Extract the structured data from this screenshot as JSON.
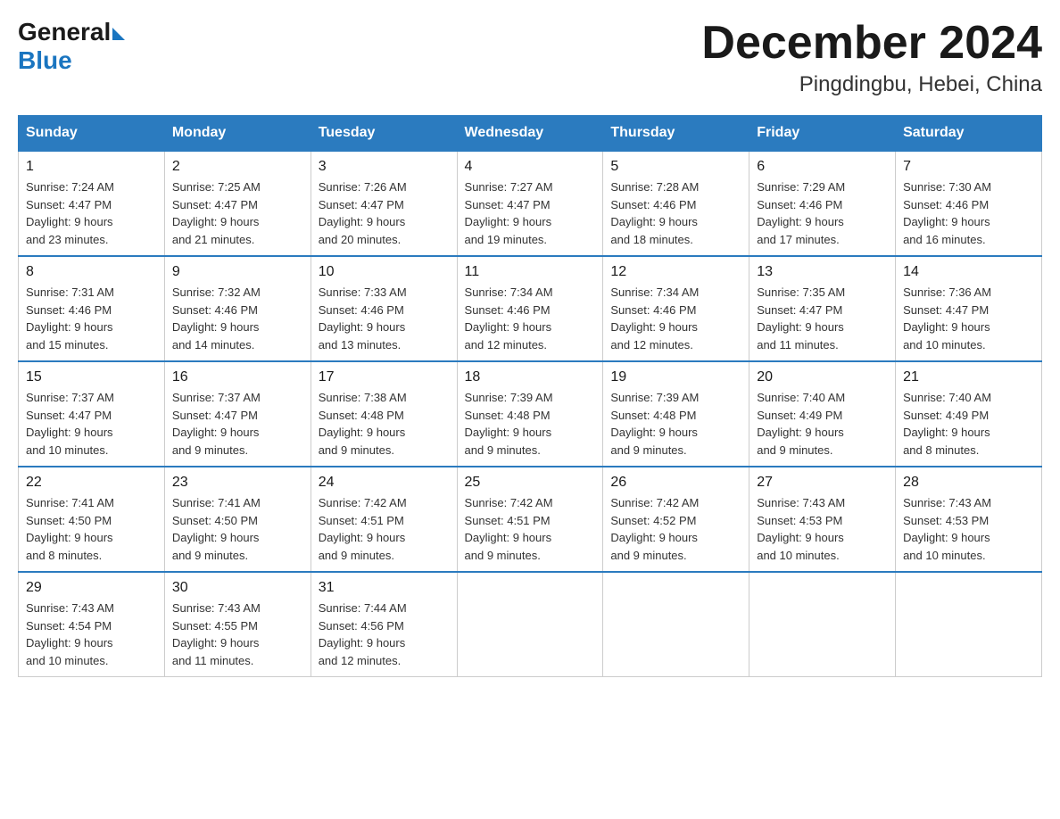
{
  "logo": {
    "general": "General",
    "blue": "Blue"
  },
  "title": "December 2024",
  "location": "Pingdingbu, Hebei, China",
  "days_of_week": [
    "Sunday",
    "Monday",
    "Tuesday",
    "Wednesday",
    "Thursday",
    "Friday",
    "Saturday"
  ],
  "weeks": [
    [
      {
        "day": "1",
        "sunrise": "7:24 AM",
        "sunset": "4:47 PM",
        "daylight": "9 hours and 23 minutes."
      },
      {
        "day": "2",
        "sunrise": "7:25 AM",
        "sunset": "4:47 PM",
        "daylight": "9 hours and 21 minutes."
      },
      {
        "day": "3",
        "sunrise": "7:26 AM",
        "sunset": "4:47 PM",
        "daylight": "9 hours and 20 minutes."
      },
      {
        "day": "4",
        "sunrise": "7:27 AM",
        "sunset": "4:47 PM",
        "daylight": "9 hours and 19 minutes."
      },
      {
        "day": "5",
        "sunrise": "7:28 AM",
        "sunset": "4:46 PM",
        "daylight": "9 hours and 18 minutes."
      },
      {
        "day": "6",
        "sunrise": "7:29 AM",
        "sunset": "4:46 PM",
        "daylight": "9 hours and 17 minutes."
      },
      {
        "day": "7",
        "sunrise": "7:30 AM",
        "sunset": "4:46 PM",
        "daylight": "9 hours and 16 minutes."
      }
    ],
    [
      {
        "day": "8",
        "sunrise": "7:31 AM",
        "sunset": "4:46 PM",
        "daylight": "9 hours and 15 minutes."
      },
      {
        "day": "9",
        "sunrise": "7:32 AM",
        "sunset": "4:46 PM",
        "daylight": "9 hours and 14 minutes."
      },
      {
        "day": "10",
        "sunrise": "7:33 AM",
        "sunset": "4:46 PM",
        "daylight": "9 hours and 13 minutes."
      },
      {
        "day": "11",
        "sunrise": "7:34 AM",
        "sunset": "4:46 PM",
        "daylight": "9 hours and 12 minutes."
      },
      {
        "day": "12",
        "sunrise": "7:34 AM",
        "sunset": "4:46 PM",
        "daylight": "9 hours and 12 minutes."
      },
      {
        "day": "13",
        "sunrise": "7:35 AM",
        "sunset": "4:47 PM",
        "daylight": "9 hours and 11 minutes."
      },
      {
        "day": "14",
        "sunrise": "7:36 AM",
        "sunset": "4:47 PM",
        "daylight": "9 hours and 10 minutes."
      }
    ],
    [
      {
        "day": "15",
        "sunrise": "7:37 AM",
        "sunset": "4:47 PM",
        "daylight": "9 hours and 10 minutes."
      },
      {
        "day": "16",
        "sunrise": "7:37 AM",
        "sunset": "4:47 PM",
        "daylight": "9 hours and 9 minutes."
      },
      {
        "day": "17",
        "sunrise": "7:38 AM",
        "sunset": "4:48 PM",
        "daylight": "9 hours and 9 minutes."
      },
      {
        "day": "18",
        "sunrise": "7:39 AM",
        "sunset": "4:48 PM",
        "daylight": "9 hours and 9 minutes."
      },
      {
        "day": "19",
        "sunrise": "7:39 AM",
        "sunset": "4:48 PM",
        "daylight": "9 hours and 9 minutes."
      },
      {
        "day": "20",
        "sunrise": "7:40 AM",
        "sunset": "4:49 PM",
        "daylight": "9 hours and 9 minutes."
      },
      {
        "day": "21",
        "sunrise": "7:40 AM",
        "sunset": "4:49 PM",
        "daylight": "9 hours and 8 minutes."
      }
    ],
    [
      {
        "day": "22",
        "sunrise": "7:41 AM",
        "sunset": "4:50 PM",
        "daylight": "9 hours and 8 minutes."
      },
      {
        "day": "23",
        "sunrise": "7:41 AM",
        "sunset": "4:50 PM",
        "daylight": "9 hours and 9 minutes."
      },
      {
        "day": "24",
        "sunrise": "7:42 AM",
        "sunset": "4:51 PM",
        "daylight": "9 hours and 9 minutes."
      },
      {
        "day": "25",
        "sunrise": "7:42 AM",
        "sunset": "4:51 PM",
        "daylight": "9 hours and 9 minutes."
      },
      {
        "day": "26",
        "sunrise": "7:42 AM",
        "sunset": "4:52 PM",
        "daylight": "9 hours and 9 minutes."
      },
      {
        "day": "27",
        "sunrise": "7:43 AM",
        "sunset": "4:53 PM",
        "daylight": "9 hours and 10 minutes."
      },
      {
        "day": "28",
        "sunrise": "7:43 AM",
        "sunset": "4:53 PM",
        "daylight": "9 hours and 10 minutes."
      }
    ],
    [
      {
        "day": "29",
        "sunrise": "7:43 AM",
        "sunset": "4:54 PM",
        "daylight": "9 hours and 10 minutes."
      },
      {
        "day": "30",
        "sunrise": "7:43 AM",
        "sunset": "4:55 PM",
        "daylight": "9 hours and 11 minutes."
      },
      {
        "day": "31",
        "sunrise": "7:44 AM",
        "sunset": "4:56 PM",
        "daylight": "9 hours and 12 minutes."
      },
      null,
      null,
      null,
      null
    ]
  ],
  "labels": {
    "sunrise": "Sunrise:",
    "sunset": "Sunset:",
    "daylight": "Daylight:"
  }
}
